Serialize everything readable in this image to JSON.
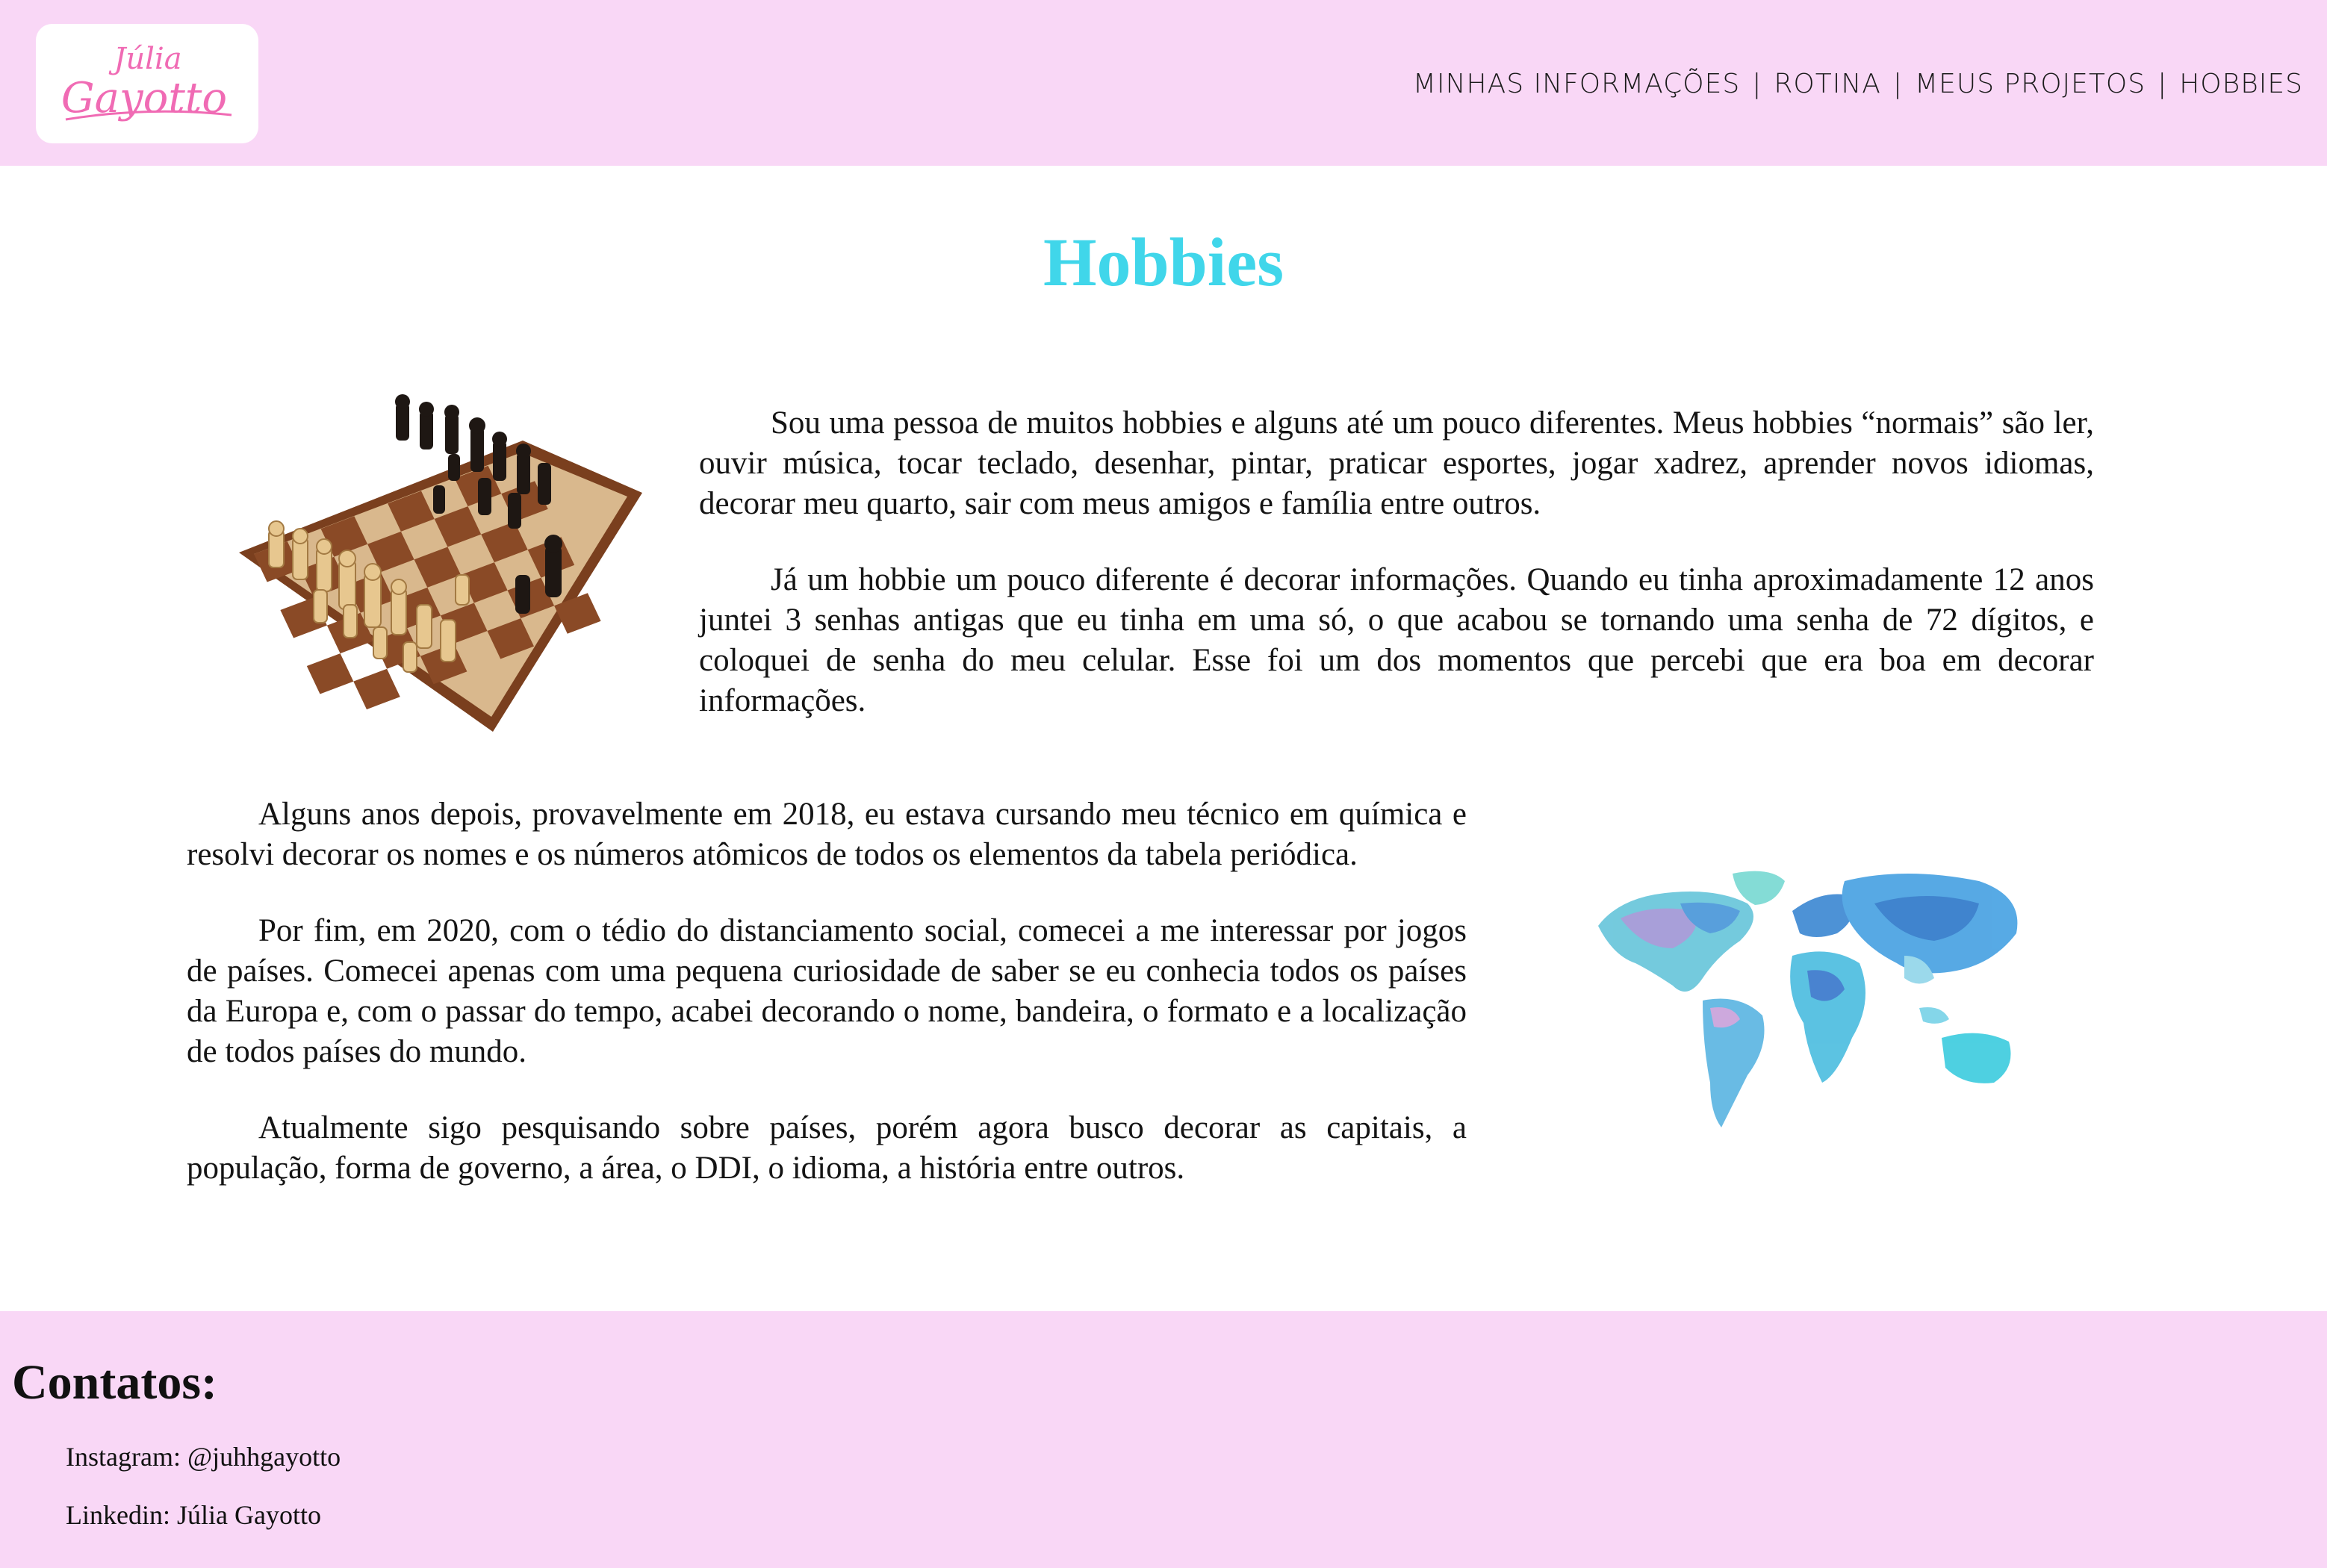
{
  "header": {
    "logo": {
      "line1": "Júlia",
      "line2": "Gayotto",
      "color": "#f06bb4"
    },
    "nav": [
      {
        "label": "MINHAS INFORMAÇÕES"
      },
      {
        "label": "ROTINA"
      },
      {
        "label": "MEUS PROJETOS"
      },
      {
        "label": "HOBBIES"
      }
    ],
    "separator": "|"
  },
  "main": {
    "title": "Hobbies",
    "title_color": "#40d6ea",
    "paragraphs": [
      "Sou uma pessoa de muitos hobbies e alguns até um pouco diferentes. Meus hobbies “normais” são ler, ouvir música, tocar teclado, desenhar, pintar, praticar esportes, jogar xadrez, aprender novos idiomas, decorar meu quarto, sair com meus amigos e família entre outros.",
      "Já um hobbie um pouco diferente é decorar informações. Quando eu tinha aproximadamente 12 anos juntei 3 senhas antigas que eu tinha em uma só, o que acabou se tornando uma senha de 72 dígitos, e coloquei de senha do meu celular. Esse foi um dos momentos que percebi que era boa em decorar informações.",
      "Alguns anos depois, provavelmente em 2018, eu estava cursando meu técnico em química e resolvi decorar os nomes e os números atômicos de todos os elementos da tabela periódica.",
      "Por fim, em 2020, com o tédio do distanciamento social, comecei a me interessar por jogos de países. Comecei apenas com uma pequena curiosidade de saber se eu conhecia todos os países da Europa e, com o passar do tempo, acabei decorando o nome, bandeira, o formato e a localização de todos países do mundo.",
      "Atualmente sigo pesquisando sobre países, porém agora busco decorar as capitais, a população, forma de governo, a área, o DDI, o idioma, a história entre outros."
    ],
    "images": {
      "chess": "chessboard-image",
      "map": "watercolor-world-map-image"
    }
  },
  "footer": {
    "title": "Contatos:",
    "contacts": [
      "Instagram: @juhhgayotto",
      "Linkedin: Júlia Gayotto"
    ],
    "background": "#f9d7f6"
  }
}
